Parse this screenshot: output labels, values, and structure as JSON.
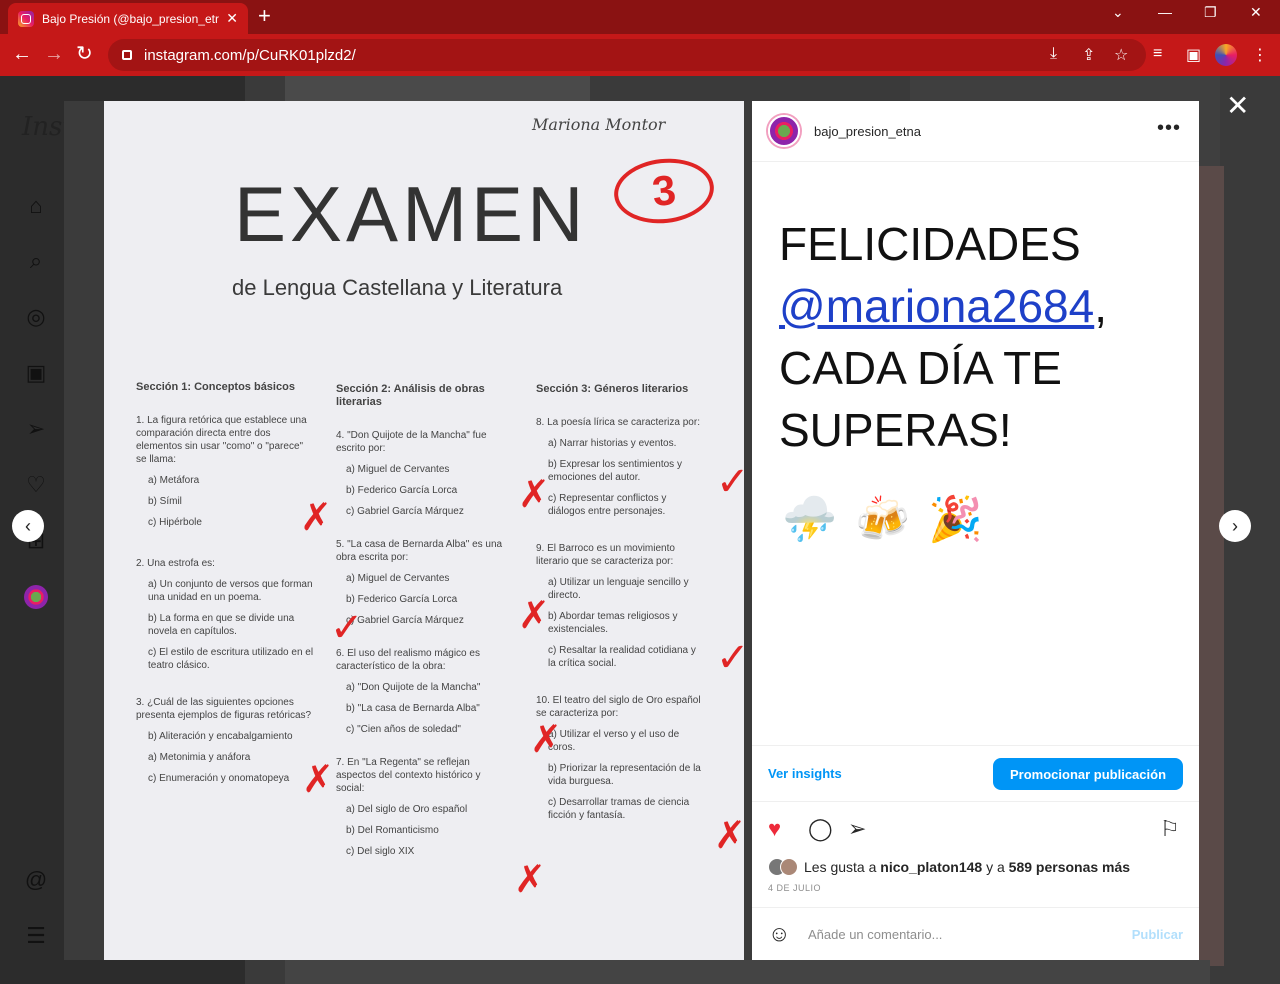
{
  "browser": {
    "tab_title": "Bajo Presión (@bajo_presion_etr",
    "url": "instagram.com/p/CuRK01plzd2/",
    "new_tab_glyph": "+",
    "controls": {
      "minimize": "—",
      "restore": "❐",
      "close": "✕",
      "chevron": "⌄"
    }
  },
  "sidebar": {
    "logo": "Inst",
    "items": [
      "home-icon",
      "search-icon",
      "explore-icon",
      "reels-icon",
      "messages-icon",
      "notifications-icon",
      "create-icon",
      "profile-icon",
      "threads-icon",
      "menu-icon"
    ]
  },
  "post": {
    "username": "bajo_presion_etna",
    "caption_line1": "FELICIDADES",
    "caption_mention": "@mariona2684",
    "caption_line2": ", CADA DÍA TE SUPERAS!",
    "emojis": [
      "⛈️",
      "🍻",
      "🎉"
    ],
    "insights_label": "Ver insights",
    "promote_label": "Promocionar publicación",
    "likes_prefix": "Les gusta a ",
    "likes_user": "nico_platon148",
    "likes_mid": " y a ",
    "likes_count": "589 personas más",
    "date": "4 DE JULIO",
    "comment_placeholder": "Añade un comentario...",
    "publish_label": "Publicar"
  },
  "exam": {
    "signature": "Mariona Montor",
    "title": "EXAMEN",
    "grade": "3",
    "subtitle": "de Lengua Castellana y Literatura",
    "sections": [
      {
        "heading": "Sección 1: Conceptos básicos",
        "questions": [
          {
            "q": "1. La figura retórica que establece una comparación directa entre dos elementos sin usar \"como\" o \"parece\" se llama:",
            "options": [
              "a) Metáfora",
              "b) Símil",
              "c) Hipérbole"
            ]
          },
          {
            "q": "2. Una estrofa es:",
            "options": [
              "a) Un conjunto de versos que forman una unidad en un poema.",
              "b) La forma en que se divide una novela en capítulos.",
              "c) El estilo de escritura utilizado en el teatro clásico."
            ]
          },
          {
            "q": "3. ¿Cuál de las siguientes opciones presenta ejemplos de figuras retóricas?",
            "options": [
              "b) Aliteración y encabalgamiento",
              "a) Metonimia y anáfora",
              "c) Enumeración y onomatopeya"
            ]
          }
        ]
      },
      {
        "heading": "Sección 2: Análisis de obras literarias",
        "questions": [
          {
            "q": "4. \"Don Quijote de la Mancha\" fue escrito por:",
            "options": [
              "a) Miguel de Cervantes",
              "b) Federico García Lorca",
              "c) Gabriel García Márquez"
            ]
          },
          {
            "q": "5. \"La casa de Bernarda Alba\" es una obra escrita por:",
            "options": [
              "a) Miguel de Cervantes",
              "b) Federico García Lorca",
              "c) Gabriel García Márquez"
            ]
          },
          {
            "q": "6. El uso del realismo mágico es característico de la obra:",
            "options": [
              "a) \"Don Quijote de la Mancha\"",
              "b) \"La casa de Bernarda Alba\"",
              "c) \"Cien años de soledad\""
            ]
          },
          {
            "q": "7. En \"La Regenta\" se reflejan aspectos del contexto histórico y social:",
            "options": [
              "a) Del siglo de Oro español",
              "b) Del Romanticismo",
              "c) Del siglo XIX"
            ]
          }
        ]
      },
      {
        "heading": "Sección 3: Géneros literarios",
        "questions": [
          {
            "q": "8. La poesía lírica se caracteriza por:",
            "options": [
              "a) Narrar historias y eventos.",
              "b) Expresar los sentimientos y emociones del autor.",
              "c) Representar conflictos y diálogos entre personajes."
            ]
          },
          {
            "q": "9. El Barroco es un movimiento literario que se caracteriza por:",
            "options": [
              "a) Utilizar un lenguaje sencillo y directo.",
              "b) Abordar temas religiosos y existenciales.",
              "c) Resaltar la realidad cotidiana y la crítica social."
            ]
          },
          {
            "q": "10. El teatro del siglo de Oro español se caracteriza por:",
            "options": [
              "a) Utilizar el verso y el uso de coros.",
              "b) Priorizar la representación de la vida burguesa.",
              "c) Desarrollar tramas de ciencia ficción y fantasía."
            ]
          }
        ]
      }
    ],
    "marks": {
      "cross": "✗",
      "check": "✓"
    }
  },
  "colors": {
    "chrome": "#c51818",
    "accent": "#0095f6",
    "heart": "#ed2a3a",
    "ink_red": "#e02525"
  }
}
